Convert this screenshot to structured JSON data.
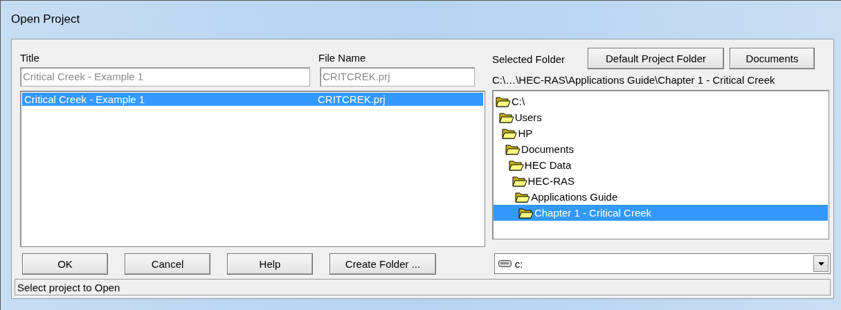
{
  "window": {
    "title": "Open Project"
  },
  "title_field": {
    "label": "Title",
    "value": "Critical Creek - Example 1",
    "disabled": true
  },
  "file_name_field": {
    "label": "File Name",
    "value": "CRITCREK.prj",
    "disabled": true
  },
  "projects": [
    {
      "title": "Critical Creek - Example 1",
      "file_name": "CRITCREK.prj",
      "selected": true
    }
  ],
  "selected_folder": {
    "label": "Selected Folder",
    "path": "C:\\…\\HEC-RAS\\Applications Guide\\Chapter 1 - Critical Creek"
  },
  "folder_buttons": [
    "Default Project Folder",
    "Documents"
  ],
  "folder_tree": [
    {
      "name": "C:\\",
      "selected": false,
      "children": [
        {
          "name": "Users",
          "selected": false,
          "children": [
            {
              "name": "HP",
              "selected": false,
              "children": [
                {
                  "name": "Documents",
                  "selected": false,
                  "children": [
                    {
                      "name": "HEC Data",
                      "selected": false,
                      "children": [
                        {
                          "name": "HEC-RAS",
                          "selected": false,
                          "children": [
                            {
                              "name": "Applications Guide",
                              "selected": false,
                              "children": [
                                {
                                  "name": "Chapter 1 - Critical Creek",
                                  "selected": true
                                }
                              ]
                            }
                          ]
                        }
                      ]
                    }
                  ]
                }
              ]
            }
          ]
        }
      ]
    }
  ],
  "drive": {
    "value": "c:"
  },
  "buttons": [
    "OK",
    "Cancel",
    "Help",
    "Create Folder ..."
  ],
  "status_bar": "Select project to Open"
}
